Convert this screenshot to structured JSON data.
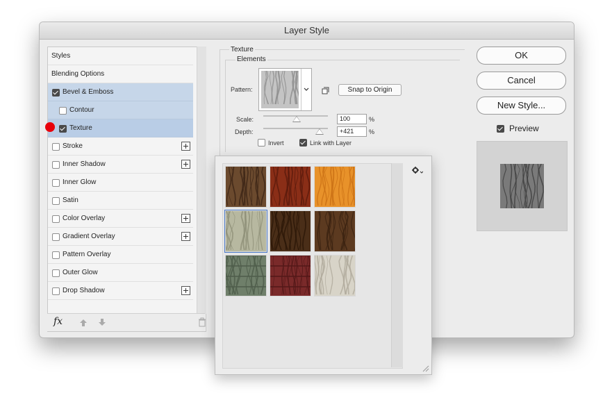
{
  "dialog": {
    "title": "Layer Style"
  },
  "styles_list": {
    "items": [
      {
        "label": "Styles",
        "checkbox": false,
        "checked": false,
        "plus": false,
        "indent": false
      },
      {
        "label": "Blending Options",
        "checkbox": false,
        "checked": false,
        "plus": false,
        "indent": false
      },
      {
        "label": "Bevel & Emboss",
        "checkbox": true,
        "checked": true,
        "plus": false,
        "indent": false
      },
      {
        "label": "Contour",
        "checkbox": true,
        "checked": false,
        "plus": false,
        "indent": true
      },
      {
        "label": "Texture",
        "checkbox": true,
        "checked": true,
        "plus": false,
        "indent": true
      },
      {
        "label": "Stroke",
        "checkbox": true,
        "checked": false,
        "plus": true,
        "indent": false
      },
      {
        "label": "Inner Shadow",
        "checkbox": true,
        "checked": false,
        "plus": true,
        "indent": false
      },
      {
        "label": "Inner Glow",
        "checkbox": true,
        "checked": false,
        "plus": false,
        "indent": false
      },
      {
        "label": "Satin",
        "checkbox": true,
        "checked": false,
        "plus": false,
        "indent": false
      },
      {
        "label": "Color Overlay",
        "checkbox": true,
        "checked": false,
        "plus": true,
        "indent": false
      },
      {
        "label": "Gradient Overlay",
        "checkbox": true,
        "checked": false,
        "plus": true,
        "indent": false
      },
      {
        "label": "Pattern Overlay",
        "checkbox": true,
        "checked": false,
        "plus": false,
        "indent": false
      },
      {
        "label": "Outer Glow",
        "checkbox": true,
        "checked": false,
        "plus": false,
        "indent": false
      },
      {
        "label": "Drop Shadow",
        "checkbox": true,
        "checked": false,
        "plus": true,
        "indent": false
      }
    ],
    "fx_label": "fx"
  },
  "texture_panel": {
    "section_label": "Texture",
    "group_label": "Elements",
    "pattern_label": "Pattern:",
    "snap_button": "Snap to Origin",
    "scale_label": "Scale:",
    "scale_value": "100",
    "scale_unit": "%",
    "depth_label": "Depth:",
    "depth_value": "+421",
    "depth_unit": "%",
    "invert_label": "Invert",
    "invert_checked": false,
    "link_label": "Link with Layer",
    "link_checked": true
  },
  "buttons": {
    "ok": "OK",
    "cancel": "Cancel",
    "new_style": "New Style..."
  },
  "preview": {
    "label": "Preview",
    "checked": true
  },
  "pattern_picker": {
    "gear_icon": "gear-icon",
    "swatches": [
      {
        "name": "dark-wood",
        "base": "#6b4a2e",
        "grain": "#3d2616"
      },
      {
        "name": "red-wood",
        "base": "#8a2e17",
        "grain": "#5a1a0c"
      },
      {
        "name": "orange-wood",
        "base": "#e8922a",
        "grain": "#c96f14"
      },
      {
        "name": "pale-green-wood",
        "base": "#b7b8a0",
        "grain": "#8f9078",
        "selected": true
      },
      {
        "name": "dark-brown-wood",
        "base": "#4a2e18",
        "grain": "#2a1608"
      },
      {
        "name": "walnut-wood",
        "base": "#5c3a20",
        "grain": "#3a2210"
      },
      {
        "name": "green-planks",
        "base": "#6f7f6a",
        "grain": "#4e5c4a"
      },
      {
        "name": "red-planks",
        "base": "#7a2a2a",
        "grain": "#531818"
      },
      {
        "name": "white-wood",
        "base": "#d8d4c8",
        "grain": "#b0aa9c"
      }
    ]
  },
  "colors": {
    "selected_row": "#c6d6e9",
    "marker": "#e8000b"
  }
}
